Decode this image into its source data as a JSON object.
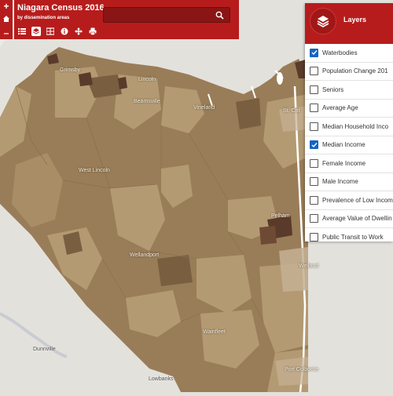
{
  "header": {
    "title": "Niagara Census 2016",
    "subtitle": "by dissemination areas",
    "search_placeholder": ""
  },
  "zoom": {
    "in_label": "+",
    "out_label": "–"
  },
  "toolbar": {
    "tools": [
      "list-icon",
      "layers-icon",
      "grid-icon",
      "info-icon",
      "move-icon",
      "print-icon"
    ],
    "active": "layers-icon"
  },
  "layers_panel": {
    "title": "Layers",
    "items": [
      {
        "label": "Waterbodies",
        "checked": true
      },
      {
        "label": "Population Change 201",
        "checked": false
      },
      {
        "label": "Seniors",
        "checked": false
      },
      {
        "label": "Average Age",
        "checked": false
      },
      {
        "label": "Median Household Inco",
        "checked": false
      },
      {
        "label": "Median Income",
        "checked": true
      },
      {
        "label": "Female Income",
        "checked": false
      },
      {
        "label": "Male Income",
        "checked": false
      },
      {
        "label": "Prevalence of Low Incom",
        "checked": false
      },
      {
        "label": "Average Value of Dwellin",
        "checked": false
      },
      {
        "label": "Public Transit to Work",
        "checked": false
      }
    ]
  },
  "map": {
    "places": [
      "Grimsby",
      "Lincoln",
      "Beamsville",
      "Vineland",
      "St. Cat",
      "West Lincoln",
      "Pelham",
      "Wellandport",
      "Welland",
      "Wainfleet",
      "Port Colborne",
      "Dunnville",
      "Lowbanks"
    ],
    "colors": {
      "light": "#b49a72",
      "mid": "#997d58",
      "dark": "#7a5e40",
      "darkest": "#5a3a2a",
      "water": "#ffffff",
      "land": "#e3e1dc",
      "brand": "#b71c1c",
      "checkbox": "#1565c0"
    }
  }
}
